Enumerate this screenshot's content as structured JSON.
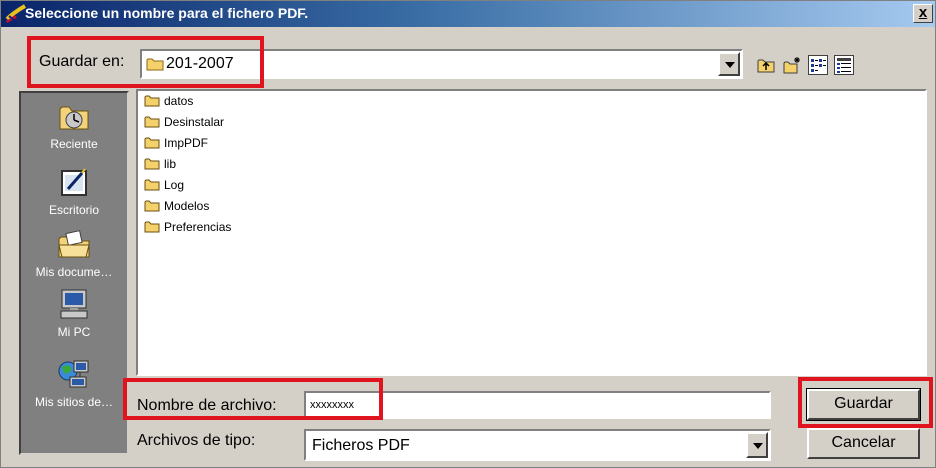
{
  "window": {
    "title": "Seleccione un nombre para el fichero PDF.",
    "close_label": "x"
  },
  "location": {
    "label": "Guardar en:",
    "current_folder": "201-2007"
  },
  "toolbar": {
    "icons": [
      "up-folder-icon",
      "new-folder-icon",
      "list-view-icon",
      "details-view-icon"
    ]
  },
  "places": [
    {
      "label": "Reciente",
      "icon": "recent-icon"
    },
    {
      "label": "Escritorio",
      "icon": "desktop-icon"
    },
    {
      "label": "Mis docume…",
      "icon": "my-documents-icon"
    },
    {
      "label": "Mi PC",
      "icon": "my-computer-icon"
    },
    {
      "label": "Mis sitios de…",
      "icon": "network-places-icon"
    }
  ],
  "files": [
    "datos",
    "Desinstalar",
    "ImpPDF",
    "lib",
    "Log",
    "Modelos",
    "Preferencias"
  ],
  "filename": {
    "label": "Nombre de archivo:",
    "value": "xxxxxxxx"
  },
  "filetype": {
    "label": "Archivos de tipo:",
    "value": "Ficheros PDF"
  },
  "buttons": {
    "save": "Guardar",
    "cancel": "Cancelar"
  },
  "colors": {
    "highlight": "#e0141e",
    "titlebar": "#0a246a",
    "face": "#d4d0c8",
    "folder": "#f5d16b"
  }
}
